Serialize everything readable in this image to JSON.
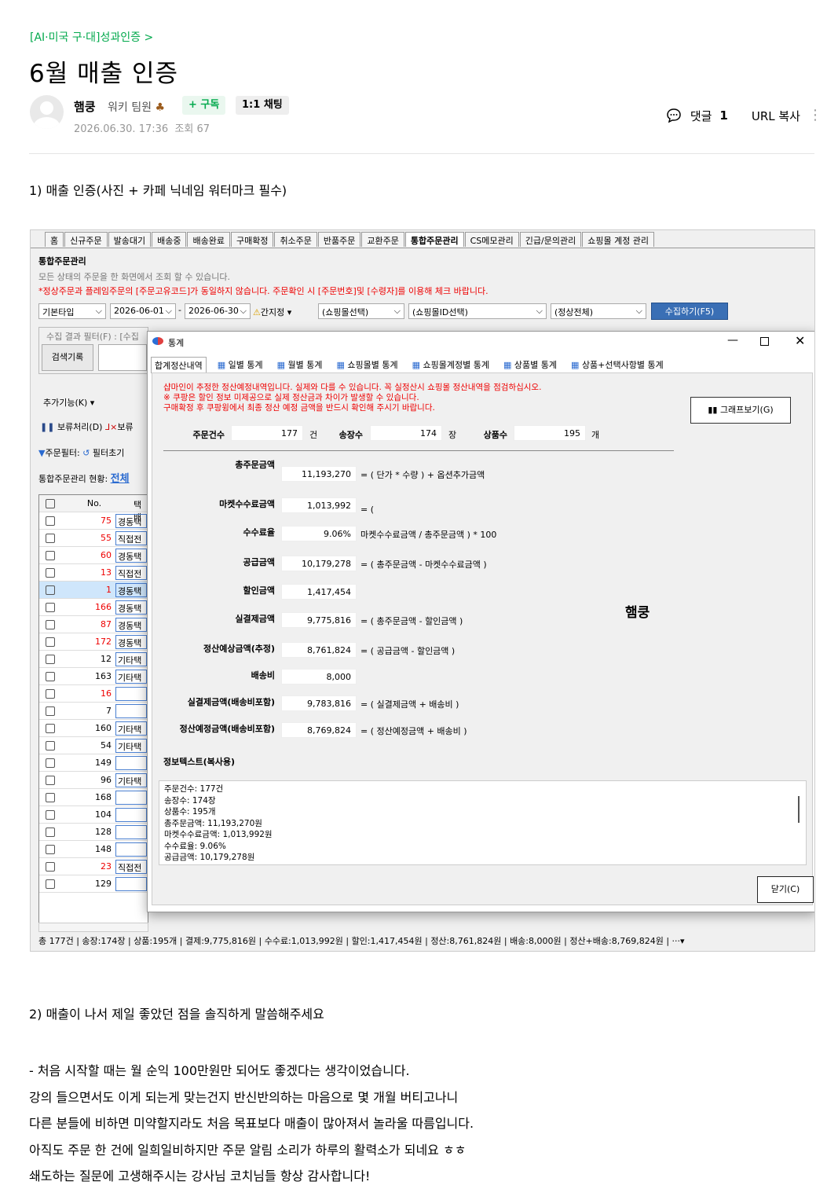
{
  "post": {
    "category": "[AI·미국 구·대]성과인증 >",
    "title": "6월 매출 인증",
    "author": "햄쿵",
    "grade": "워키 팀원",
    "subscribe": "+ 구독",
    "chat": "1:1 채팅",
    "date": "2026.06.30. 17:36",
    "views": "조회 67",
    "comment_label": "댓글",
    "comment_count": "1",
    "url_copy": "URL 복사",
    "heading1": "1) 매출 인증(사진 + 카페 닉네임 워터마크 필수)",
    "heading2": "2) 매출이 나서 제일 좋았던 점을 솔직하게 말씀해주세요",
    "body": [
      "- 처음 시작할 때는 월 순익 100만원만 되어도 좋겠다는 생각이었습니다.",
      "강의 들으면서도 이게 되는게 맞는건지 반신반의하는 마음으로 몇 개월 버티고나니",
      "다른 분들에 비하면 미약할지라도 처음 목표보다 매출이 많아져서 놀라울 따름입니다.",
      "아직도 주문 한 건에 일희일비하지만 주문 알림 소리가 하루의 활력소가 되네요 ㅎㅎ",
      "쇄도하는 질문에 고생해주시는 강사님 코치님들 항상 감사합니다!"
    ]
  },
  "app": {
    "tabs": [
      "홈",
      "신규주문",
      "발송대기",
      "배송중",
      "배송완료",
      "구매확정",
      "취소주문",
      "반품주문",
      "교환주문",
      "통합주문관리",
      "CS메모관리",
      "긴급/문의관리",
      "쇼핑몰 계정 관리"
    ],
    "section_title": "통합주문관리",
    "desc1": "모든 상태의 주문을 한 화면에서 조회 할 수 있습니다.",
    "desc2": "*정상주문과 플레임주문의 [주문고유코드]가 동일하지 않습니다. 주문확인 시 [주문번호]및 [수령자]를 이용해 체크 바랍니다.",
    "type_select": "기본타입",
    "date_from": "2026-06-01",
    "date_to": "2026-06-30",
    "quick": "간지정",
    "mall_select": "(쇼핑몰선택)",
    "mall_id_select": "(쇼핑몰ID선택)",
    "state_select": "(정상전체)",
    "collect_btn": "수집하기(F5)",
    "filter_label": "수집 결과 필터(F) : [수집",
    "search_history": "검색기록",
    "extra": "추가기능(K)",
    "hold": "보류처리(D)",
    "hold2": "보류",
    "order_filter": "주문필터:",
    "filter_reset": "필터초기",
    "status_label": "통합주문관리 현황:",
    "status_all": "전체",
    "col_no": "No.",
    "col_type": "택배",
    "rows": [
      {
        "no": "75",
        "type": "경동택",
        "red": true
      },
      {
        "no": "55",
        "type": "직접전",
        "red": true
      },
      {
        "no": "60",
        "type": "경동택",
        "red": true
      },
      {
        "no": "13",
        "type": "직접전",
        "red": true
      },
      {
        "no": "1",
        "type": "경동택",
        "red": true
      },
      {
        "no": "166",
        "type": "경동택",
        "red": true
      },
      {
        "no": "87",
        "type": "경동택",
        "red": true
      },
      {
        "no": "172",
        "type": "경동택",
        "red": true
      },
      {
        "no": "12",
        "type": "기타택",
        "red": false
      },
      {
        "no": "163",
        "type": "기타택",
        "red": false
      },
      {
        "no": "16",
        "type": "",
        "red": true
      },
      {
        "no": "7",
        "type": "",
        "red": false
      },
      {
        "no": "160",
        "type": "기타택",
        "red": false
      },
      {
        "no": "54",
        "type": "기타택",
        "red": false
      },
      {
        "no": "149",
        "type": "",
        "red": false
      },
      {
        "no": "96",
        "type": "기타택",
        "red": false
      },
      {
        "no": "168",
        "type": "",
        "red": false
      },
      {
        "no": "104",
        "type": "",
        "red": false
      },
      {
        "no": "128",
        "type": "",
        "red": false
      },
      {
        "no": "148",
        "type": "",
        "red": false
      },
      {
        "no": "23",
        "type": "직접전",
        "red": true
      },
      {
        "no": "129",
        "type": "",
        "red": false
      }
    ],
    "status_bar": "총 177건 | 송장:174장 | 상품:195개 | 결제:9,775,816원 | 수수료:1,013,992원 | 할인:1,417,454원 | 정산:8,761,824원 | 배송:8,000원 | 정산+배송:8,769,824원 |",
    "status_more": "···▾"
  },
  "dialog": {
    "title": "통계",
    "tabs": [
      "합계정산내역",
      "일별 통계",
      "월별 통계",
      "쇼핑몰별 통계",
      "쇼핑몰계정별 통계",
      "상품별 통계",
      "상품+선택사항별 통계"
    ],
    "warn1": "샵마인이 추정한 정산예정내역입니다. 실제와 다를 수 있습니다. 꼭 실정산시 쇼핑몰 정산내역을 점검하십시오.",
    "warn2": "※ 쿠팡은 할인 정보 미제공으로 실제 정산금과 차이가 발생할 수 있습니다.",
    "warn3": "구매확정 후 쿠팡윙에서 최종 정산 예정 금액을 반드시 확인해 주시기 바랍니다.",
    "graph_btn": "그래프보기(G)",
    "order_count_label": "주문건수",
    "order_count": "177",
    "order_unit": "건",
    "invoice_label": "송장수",
    "invoice": "174",
    "invoice_unit": "장",
    "product_label": "상품수",
    "product": "195",
    "product_unit": "개",
    "watermark": "햄쿵",
    "fields": [
      {
        "label": "총주문금액",
        "value": "11,193,270",
        "formula": "=  (  단가    *    수량  )  +  옵션추가금액"
      },
      {
        "label": "마켓수수료금액",
        "value": "1,013,992",
        "formula": "=  ("
      },
      {
        "label": "수수료율",
        "value": "9.06%",
        "formula": "         마켓수수료금액     /     총주문금액  )  * 100"
      },
      {
        "label": "공급금액",
        "value": "10,179,278",
        "formula": "=  (  총주문금액     -     마켓수수료금액  )"
      },
      {
        "label": "할인금액",
        "value": "1,417,454",
        "formula": ""
      },
      {
        "label": "실결제금액",
        "value": "9,775,816",
        "formula": "=  (  총주문금액     -     할인금액  )"
      },
      {
        "label": "정산예상금액(추정)",
        "value": "8,761,824",
        "formula": "=  (  공급금액     -     할인금액  )"
      },
      {
        "label": "배송비",
        "value": "8,000",
        "formula": ""
      },
      {
        "label": "실결제금액(배송비포함)",
        "value": "9,783,816",
        "formula": "=  (    실결제금액     +   배송비  )"
      },
      {
        "label": "정산예정금액(배송비포함)",
        "value": "8,769,824",
        "formula": "=  (   정산예정금액     +   배송비  )"
      }
    ],
    "info_label": "정보텍스트(복사용)",
    "info_lines": [
      "주문건수: 177건",
      "송장수: 174장",
      "상품수: 195개",
      "총주문금액: 11,193,270원",
      "마켓수수료금액: 1,013,992원",
      "수수료율: 9.06%",
      "공급금액: 10,179,278원"
    ],
    "close_btn": "닫기(C)"
  }
}
